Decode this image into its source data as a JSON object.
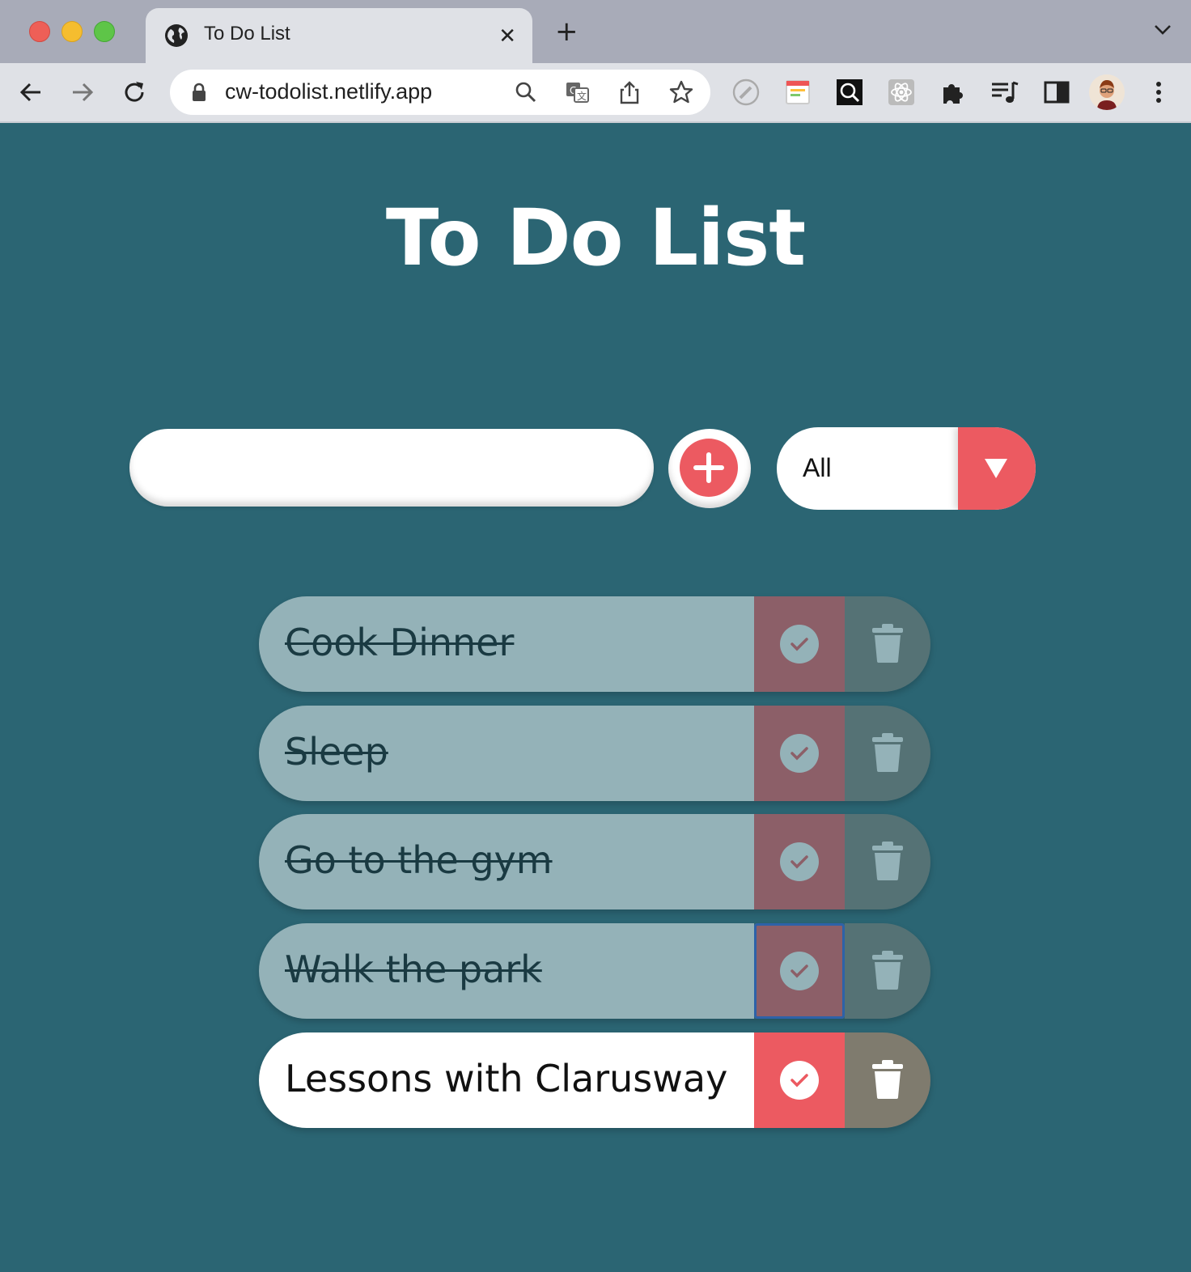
{
  "browser": {
    "tab_title": "To Do List",
    "tab_close": "✕",
    "new_tab": "+",
    "url": "cw-todolist.netlify.app"
  },
  "page": {
    "title": "To Do List",
    "input": {
      "value": "",
      "placeholder": ""
    },
    "add_button": "+",
    "filter": {
      "selected": "All"
    },
    "todos": [
      {
        "text": "Cook Dinner",
        "completed": true
      },
      {
        "text": "Sleep",
        "completed": true
      },
      {
        "text": "Go to the gym",
        "completed": true
      },
      {
        "text": "Walk the park",
        "completed": true
      },
      {
        "text": "Lessons with Clarusway",
        "completed": false
      }
    ]
  },
  "colors": {
    "background": "#2b6573",
    "accent": "#ec5a61",
    "completed_item": "#94b2b8",
    "completed_check": "#8c5f68",
    "completed_trash": "#557275",
    "active_trash": "#7f7b6e"
  }
}
